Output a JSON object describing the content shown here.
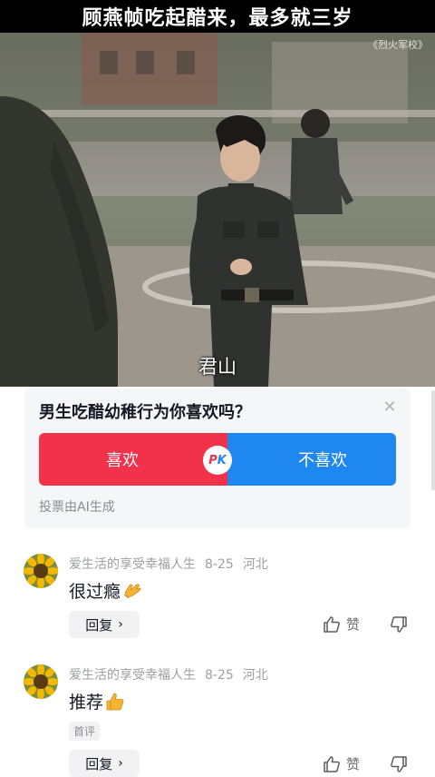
{
  "video": {
    "title": "顾燕帧吃起醋来，最多就三岁",
    "watermark": "《烈火军校》",
    "subtitle": "君山"
  },
  "poll": {
    "question": "男生吃醋幼稚行为你喜欢吗？",
    "option_like": "喜欢",
    "option_dislike": "不喜欢",
    "pk_p": "P",
    "pk_k": "K",
    "footer": "投票由AI生成",
    "colors": {
      "like": "#f2324b",
      "dislike": "#1e87f0"
    }
  },
  "comments": [
    {
      "username": "爱生活的享受幸福人生",
      "date": "8-25",
      "location": "河北",
      "text": "很过瘾",
      "emoji_icon": "clapping-hand-icon",
      "reply_label": "回复",
      "like_label": "赞"
    },
    {
      "username": "爱生活的享受幸福人生",
      "date": "8-25",
      "location": "河北",
      "text": "推荐",
      "emoji_icon": "thumbs-up-icon",
      "tag": "首评",
      "reply_label": "回复",
      "like_label": "赞"
    }
  ]
}
